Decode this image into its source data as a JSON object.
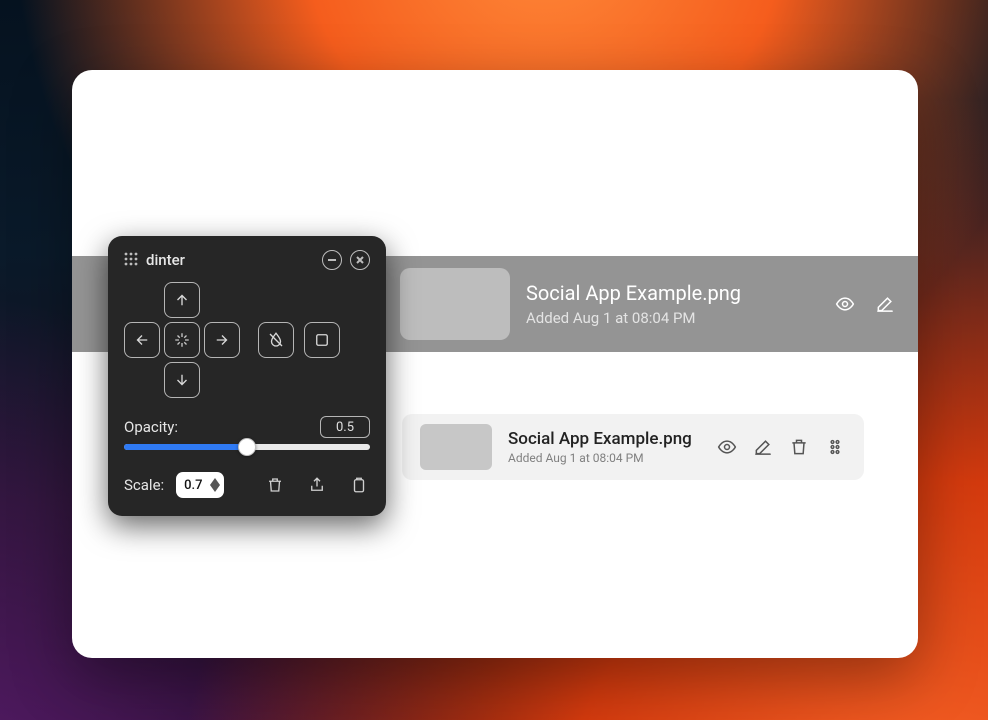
{
  "panel": {
    "title": "dinter",
    "opacity_label": "Opacity:",
    "opacity_value": "0.5",
    "opacity_fraction": 0.5,
    "scale_label": "Scale:",
    "scale_value": "0.7"
  },
  "file_large": {
    "title": "Social App Example.png",
    "subtitle": "Added Aug 1 at 08:04 PM"
  },
  "file_small": {
    "title": "Social App Example.png",
    "subtitle": "Added Aug 1 at 08:04 PM"
  }
}
